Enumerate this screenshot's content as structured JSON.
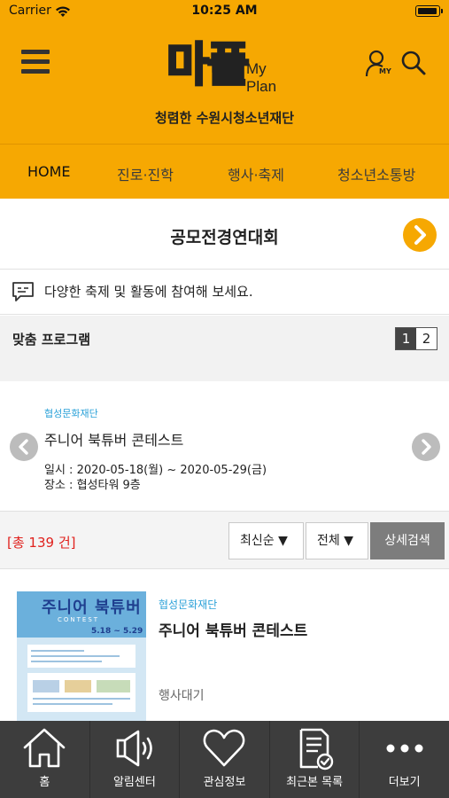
{
  "status_bar": {
    "carrier": "Carrier",
    "time": "10:25 AM"
  },
  "header": {
    "logo_main": "마플",
    "logo_sub_1": "My",
    "logo_sub_2": "Plan",
    "tagline": "청렴한 수원시청소년재단",
    "my_label": "MY",
    "brand_color": "#f6a802"
  },
  "nav": {
    "items": [
      {
        "label": "HOME"
      },
      {
        "label": "진로·진학"
      },
      {
        "label": "행사·축제"
      },
      {
        "label": "청소년소통방"
      }
    ]
  },
  "section": {
    "title": "공모전경연대회",
    "description": "다양한 축제 및 활동에 참여해 보세요."
  },
  "program": {
    "title": "맞춤 프로그램",
    "pages": [
      "1",
      "2"
    ],
    "current_page": "1",
    "card": {
      "org": "협성문화재단",
      "title": "주니어 북튜버 콘테스트",
      "date": "일시 : 2020-05-18(월) ~ 2020-05-29(금)",
      "place": "장소 : 협성타워 9층"
    }
  },
  "filter": {
    "count_text": "[총 139 건]",
    "sort_label": "최신순 ▼",
    "category_label": "전체 ▼",
    "detail_search_label": "상세검색"
  },
  "list": [
    {
      "org": "협성문화재단",
      "title": "주니어 북튜버 콘테스트",
      "status": "행사대기",
      "poster": {
        "title": "주니어 북튜버",
        "sub": "CONTEST",
        "date": "5.18 ~ 5.29"
      }
    }
  ],
  "tabbar": {
    "items": [
      {
        "label": "홈",
        "icon": "home-icon"
      },
      {
        "label": "알림센터",
        "icon": "speaker-icon"
      },
      {
        "label": "관심정보",
        "icon": "heart-icon"
      },
      {
        "label": "최근본 목록",
        "icon": "document-check-icon"
      },
      {
        "label": "더보기",
        "icon": "more-icon"
      }
    ]
  }
}
